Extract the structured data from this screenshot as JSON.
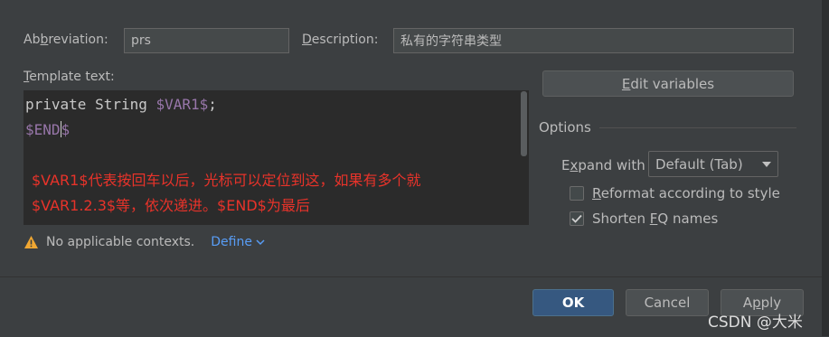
{
  "header": {
    "abbreviation_prefix": "Ab",
    "abbreviation_mnemonic": "b",
    "abbreviation_suffix": "reviation:",
    "abbreviation_value": "prs",
    "description_mnemonic": "D",
    "description_suffix": "escription:",
    "description_value": "私有的字符串类型"
  },
  "template": {
    "label_mnemonic": "T",
    "label_suffix": "emplate text:",
    "line1_keyword": "private String ",
    "line1_var": "$VAR1$",
    "line1_end": ";",
    "line2_a": "$END",
    "line2_b": "$",
    "annotation_line1": "$VAR1$代表按回车以后，光标可以定位到这，如果有多个就",
    "annotation_line2": "$VAR1.2.3$等，依次递进。$END$为最后"
  },
  "contexts": {
    "warning_text": "No applicable contexts.",
    "define_link": "Define"
  },
  "edit_variables": {
    "mnemonic": "E",
    "suffix": "dit variables"
  },
  "options": {
    "title": "Options",
    "expand_with_prefix": "E",
    "expand_with_mnemonic": "x",
    "expand_with_suffix": "pand with",
    "expand_with_value": "Default (Tab)",
    "reformat_mnemonic": "R",
    "reformat_suffix": "eformat according to style",
    "reformat_checked": false,
    "shorten_prefix": "Shorten ",
    "shorten_mnemonic": "F",
    "shorten_suffix": "Q names",
    "shorten_checked": true
  },
  "buttons": {
    "ok": "OK",
    "cancel": "Cancel",
    "apply_prefix": "A",
    "apply_mnemonic": "p",
    "apply_suffix": "ply"
  },
  "watermark": "CSDN @大米",
  "colors": {
    "background": "#3c3f41",
    "editor_bg": "#2b2b2b",
    "variable": "#9876aa",
    "annotation": "#e8332a",
    "link": "#589df6",
    "ok_button": "#365880",
    "warning": "#f0a732"
  }
}
